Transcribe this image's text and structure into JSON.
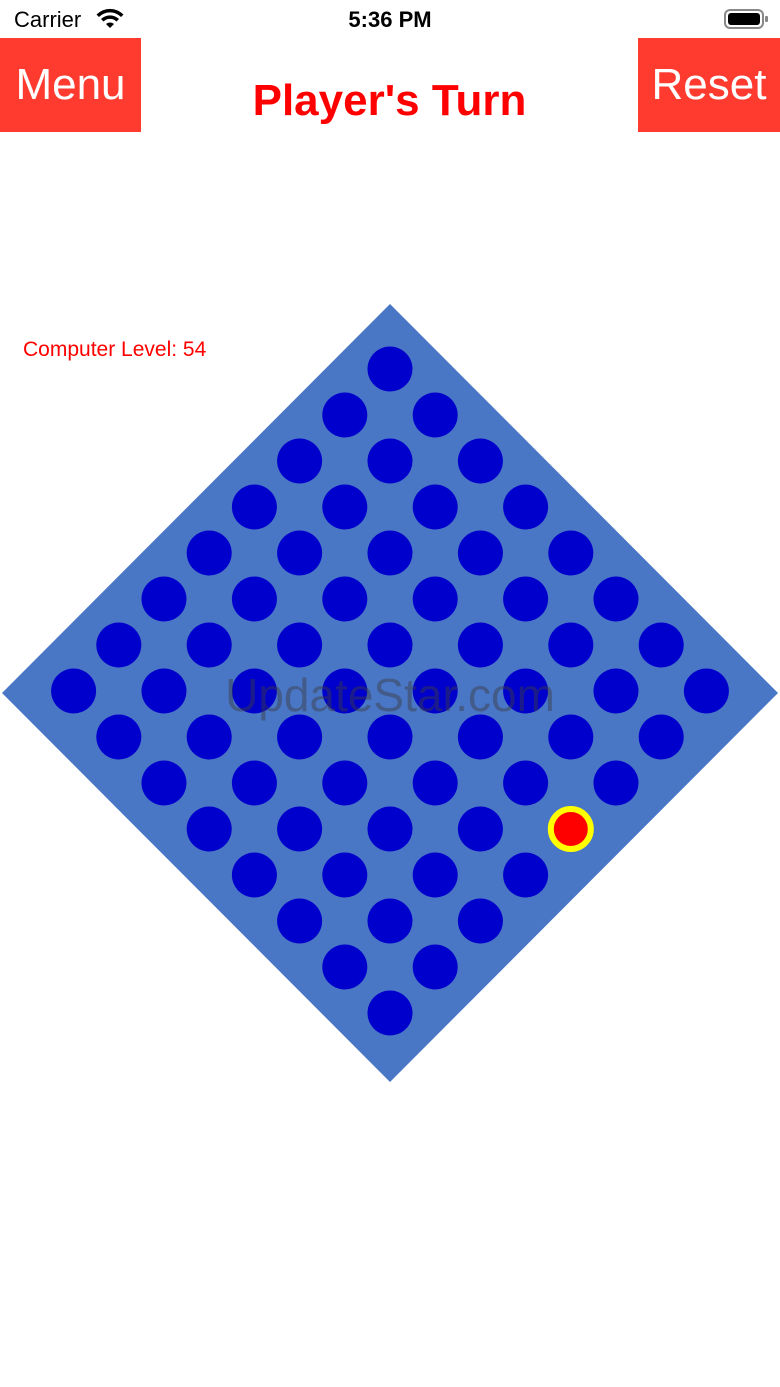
{
  "status_bar": {
    "carrier": "Carrier",
    "time": "5:36 PM"
  },
  "header": {
    "menu_label": "Menu",
    "reset_label": "Reset",
    "turn_text": "Player's Turn"
  },
  "game": {
    "level_text": "Computer Level: 54",
    "watermark": "UpdateStar.com",
    "board_size": 8,
    "player_piece": {
      "row": 7,
      "col": 3
    },
    "colors": {
      "board": "#4a76c6",
      "hole": "#0000cc",
      "player_piece": "#ff0000",
      "piece_ring": "#ffff00",
      "accent": "#ff3b30"
    }
  }
}
